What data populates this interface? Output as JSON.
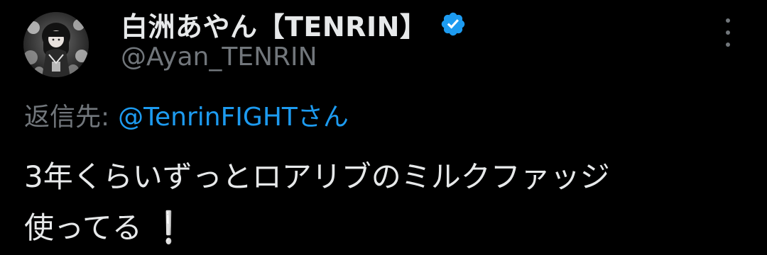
{
  "author": {
    "display_name": "白洲あやん【TENRIN】",
    "handle": "@Ayan_TENRIN",
    "verified_icon": "verified-badge-icon",
    "verified_color": "#1d9bf0"
  },
  "actions": {
    "more_icon": "more-vertical-icon"
  },
  "reply": {
    "label": "返信先:",
    "mention": "@TenrinFIGHTさん"
  },
  "tweet": {
    "line1": "3年くらいずっとロアリブのミルクファッジ",
    "line2": "使ってる",
    "emoji": "❕"
  },
  "colors": {
    "background": "#000000",
    "primary_text": "#e7e9ea",
    "secondary_text": "#71767b",
    "link": "#1d9bf0"
  }
}
